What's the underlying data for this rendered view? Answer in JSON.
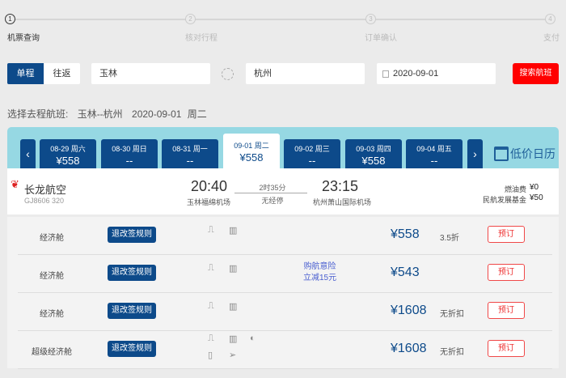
{
  "steps": [
    {
      "num": "1",
      "label": "机票查询"
    },
    {
      "num": "2",
      "label": "核对行程"
    },
    {
      "num": "3",
      "label": "订单确认"
    },
    {
      "num": "4",
      "label": "支付"
    }
  ],
  "search": {
    "one_way": "单程",
    "round_trip": "往返",
    "from": "玉林",
    "to": "杭州",
    "date": "2020-09-01",
    "button": "搜索航班"
  },
  "summary": {
    "label": "选择去程航班:",
    "route": "玉林--杭州",
    "date": "2020-09-01",
    "weekday": "周二"
  },
  "dates": [
    {
      "date": "08-29 周六",
      "price": "¥558"
    },
    {
      "date": "08-30 周日",
      "price": "--"
    },
    {
      "date": "08-31 周一",
      "price": "--"
    },
    {
      "date": "09-01 周二",
      "price": "¥558"
    },
    {
      "date": "09-02 周三",
      "price": "--"
    },
    {
      "date": "09-03 周四",
      "price": "¥558"
    },
    {
      "date": "09-04 周五",
      "price": "--"
    }
  ],
  "calendar_label": "低价日历",
  "flight": {
    "airline": "长龙航空",
    "number": "GJ8606",
    "aircraft": "320",
    "dep_time": "20:40",
    "dep_airport": "玉林福绵机场",
    "duration": "2时35分",
    "stops": "无经停",
    "arr_time": "23:15",
    "arr_airport": "杭州萧山国际机场",
    "fuel_label": "燃油费",
    "fuel": "¥0",
    "fund_label": "民航发展基金",
    "fund": "¥50"
  },
  "fares": [
    {
      "class": "经济舱",
      "rule": "退改签规则",
      "promo": "",
      "promo2": "",
      "price": "¥558",
      "discount": "3.5折",
      "book": "预订"
    },
    {
      "class": "经济舱",
      "rule": "退改签规则",
      "promo": "购航意险",
      "promo2": "立减15元",
      "price": "¥543",
      "discount": "",
      "book": "预订"
    },
    {
      "class": "经济舱",
      "rule": "退改签规则",
      "promo": "",
      "promo2": "",
      "price": "¥1608",
      "discount": "无折扣",
      "book": "预订"
    },
    {
      "class": "超级经济舱",
      "rule": "退改签规则",
      "promo": "",
      "promo2": "",
      "price": "¥1608",
      "discount": "无折扣",
      "book": "预订"
    }
  ],
  "colors": {
    "primary": "#0d4a8a",
    "search": "#ff0000",
    "strip": "#96d8e3"
  }
}
